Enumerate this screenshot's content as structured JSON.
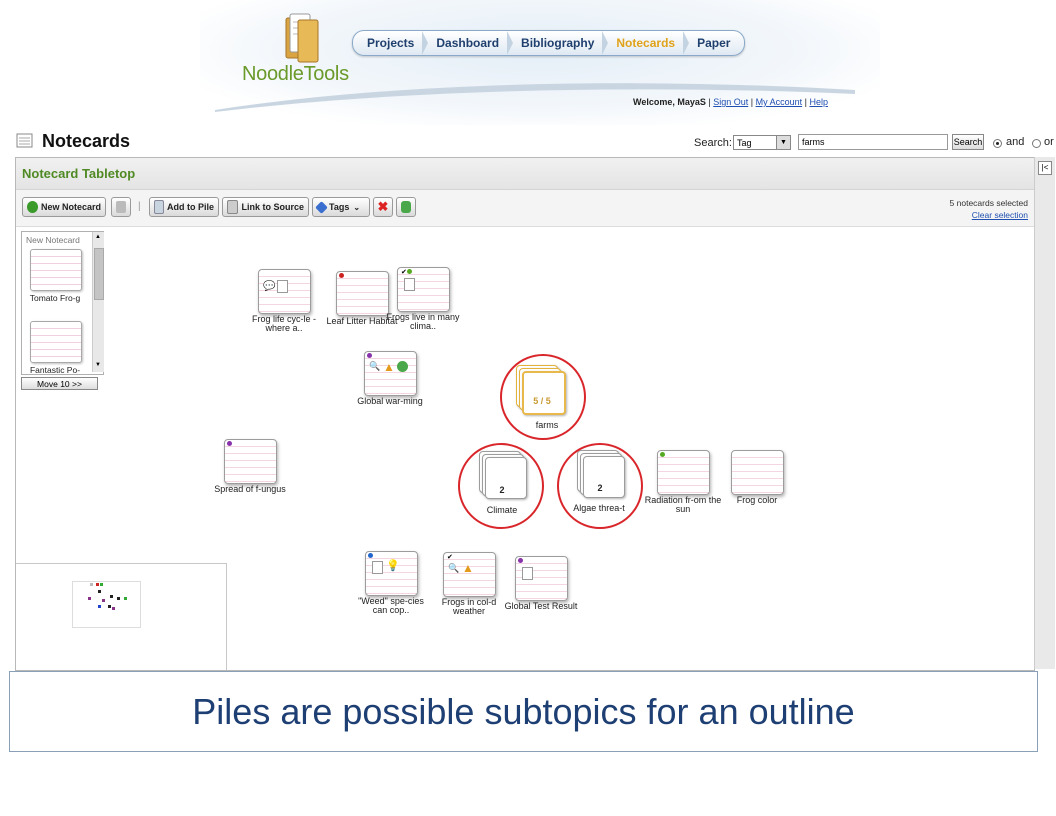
{
  "header": {
    "logo_text": "NoodleTools",
    "nav": [
      "Projects",
      "Dashboard",
      "Bibliography",
      "Notecards",
      "Paper"
    ],
    "active_nav": "Notecards",
    "welcome_prefix": "Welcome, MayaS",
    "links": [
      "Sign Out",
      "My Account",
      "Help"
    ]
  },
  "page": {
    "title": "Notecards",
    "search_label": "Search:",
    "search_type": "Tag",
    "search_value": "farms",
    "search_button": "Search",
    "radio_and": "and",
    "radio_or": "or"
  },
  "tabletop": {
    "title": "Notecard Tabletop",
    "toolbar": {
      "new_notecard": "New Notecard",
      "add_to_pile": "Add to Pile",
      "link_to_source": "Link to Source",
      "tags": "Tags"
    },
    "selection": {
      "count_text": "5 notecards selected",
      "clear": "Clear selection"
    },
    "side_panel": {
      "header": "New Notecard",
      "cards": [
        "Tomato Fro-g",
        "Fantastic Po-"
      ],
      "move_button": "Move 10 >>"
    },
    "cards": [
      {
        "label": "Frog life cyc-le - where a..",
        "dot": ""
      },
      {
        "label": "Leaf Litter Habitat",
        "dot": "#cc2222"
      },
      {
        "label": "Frogs live in many clima..",
        "dot": "#55aa22"
      },
      {
        "label": "Global war-ming",
        "dot": "#8833aa"
      },
      {
        "label": "Spread of f-ungus",
        "dot": "#8833aa"
      },
      {
        "label": "Radiation fr-om the sun",
        "dot": "#55aa22"
      },
      {
        "label": "Frog color",
        "dot": ""
      },
      {
        "label": "\"Weed\" spe-cies can cop..",
        "dot": "#2266cc"
      },
      {
        "label": "Frogs in col-d weather",
        "dot": "#222222"
      },
      {
        "label": "Global Test Result",
        "dot": "#8833aa"
      }
    ],
    "piles": [
      {
        "label": "farms",
        "count": "5 / 5"
      },
      {
        "label": "Climate",
        "count": "2"
      },
      {
        "label": "Algae threa-t",
        "count": "2"
      }
    ]
  },
  "caption": "Piles are possible subtopics for an outline",
  "colors": {
    "accent": "#4f8a24",
    "highlight_circle": "#d9262b",
    "nav_active": "#e0a21a",
    "caption_text": "#1e3f73"
  }
}
